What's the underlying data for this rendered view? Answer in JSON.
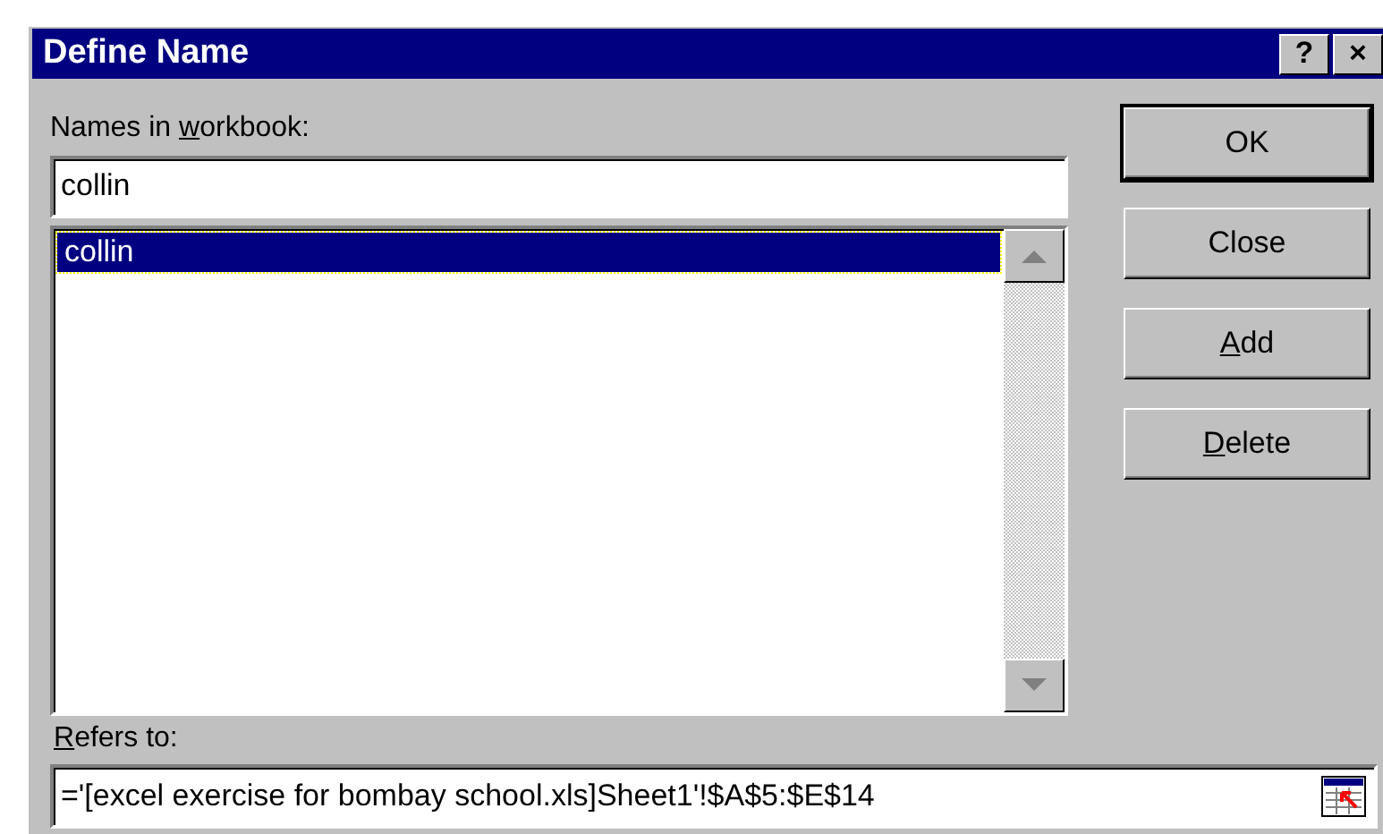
{
  "window": {
    "title": "Define Name",
    "title_buttons": [
      "?",
      "×"
    ]
  },
  "names_label": {
    "before": "Names in ",
    "access_key": "w",
    "after": "orkbook:"
  },
  "name_field": {
    "value": "collin"
  },
  "names_list": [
    {
      "label": "collin",
      "selected": true
    }
  ],
  "buttons": [
    {
      "label": "OK",
      "default": true
    },
    {
      "label": "Close",
      "default": false
    },
    {
      "access_key": "A",
      "after": "dd",
      "default": false
    },
    {
      "access_key": "D",
      "after": "elete",
      "default": false
    }
  ],
  "refers_label": {
    "access_key": "R",
    "after": "efers to:"
  },
  "refers_field": {
    "value": "='[excel exercise for bombay school.xls]Sheet1'!$A$5:$E$14"
  }
}
